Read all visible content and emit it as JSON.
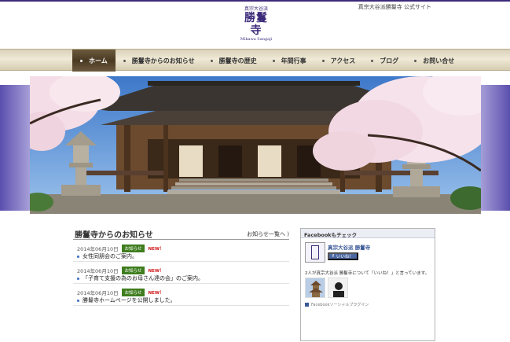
{
  "header": {
    "tagline": "真宗大谷派勝鬘寺 公式サイト",
    "logo_small": "真宗大谷派",
    "logo_main": "勝鬘寺",
    "logo_roman": "Mikawa Sangaji"
  },
  "nav": {
    "items": [
      {
        "label": "ホーム"
      },
      {
        "label": "勝鬘寺からのお知らせ"
      },
      {
        "label": "勝鬘寺の歴史"
      },
      {
        "label": "年間行事"
      },
      {
        "label": "アクセス"
      },
      {
        "label": "ブログ"
      },
      {
        "label": "お問い合せ"
      }
    ]
  },
  "news": {
    "title": "勝鬘寺からのお知らせ",
    "more_link": "お知らせ一覧へ )",
    "items": [
      {
        "date": "2014年06月10日",
        "tag": "お知らせ",
        "badge": "NEW！",
        "text": "女性同朋会のご案内。"
      },
      {
        "date": "2014年06月10日",
        "tag": "お知らせ",
        "badge": "NEW！",
        "text": "「子育て支援の為のお母さん達の会」のご案内。"
      },
      {
        "date": "2014年06月10日",
        "tag": "お知らせ",
        "badge": "NEW！",
        "text": "勝鬘寺ホームページを公開しました。"
      }
    ]
  },
  "facebook": {
    "heading": "Facebookもチェック",
    "page_name": "真宗大谷派 勝鬘寺",
    "like_label": "いいね！",
    "like_count_text": "2人が真宗大谷派 勝鬘寺について「いいね！」と言っています。",
    "plugin_text": "Facebookソーシャルプラグイン"
  },
  "colors": {
    "brand": "#3b2a7a",
    "nav_active": "#4a3a22",
    "tag_green": "#3f7d1f",
    "new_red": "#d01818"
  }
}
